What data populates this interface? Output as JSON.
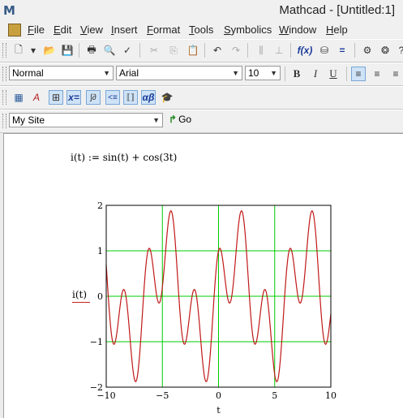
{
  "window": {
    "title": "Mathcad - [Untitled:1]",
    "logo": "M"
  },
  "menu": [
    "File",
    "Edit",
    "View",
    "Insert",
    "Format",
    "Tools",
    "Symbolics",
    "Window",
    "Help"
  ],
  "toolbar_icons": [
    "new-file",
    "open-folder",
    "save",
    "print",
    "print-preview",
    "spell-check",
    "cut",
    "copy",
    "paste",
    "undo",
    "redo",
    "align",
    "function",
    "insert-unit",
    "resource"
  ],
  "format_toolbar": {
    "style": "Normal",
    "font": "Arial",
    "size": "10",
    "bold": "B",
    "italic": "I",
    "underline": "U"
  },
  "math_toolbar": {
    "calculator": "▦",
    "graph": "A",
    "matrix": "⊞",
    "evaluation": "x=",
    "calculus": "∫∂",
    "boolean": "<≡",
    "programming": "⟦⟧",
    "greek": "αβ",
    "symbolic": "🎓"
  },
  "resource_bar": {
    "site": "My Site",
    "go_label": "Go"
  },
  "worksheet": {
    "formula": "i(t) := sin(t) + cos(3t)",
    "plot_ylabel": "i(t)",
    "plot_xlabel": "t"
  },
  "chart_data": {
    "type": "line",
    "function": "sin(t) + cos(3t)",
    "x_ticks": [
      "−10",
      "−5",
      "0",
      "5",
      "10"
    ],
    "y_ticks": [
      "−2",
      "−1",
      "0",
      "1",
      "2"
    ],
    "xlim": [
      -10,
      10
    ],
    "ylim": [
      -2,
      2
    ],
    "xlabel": "t",
    "ylabel": "i(t)",
    "grid": true,
    "colors": {
      "trace": "#c01818",
      "grid": "#00cc00",
      "axis_frame": "#000000"
    }
  }
}
